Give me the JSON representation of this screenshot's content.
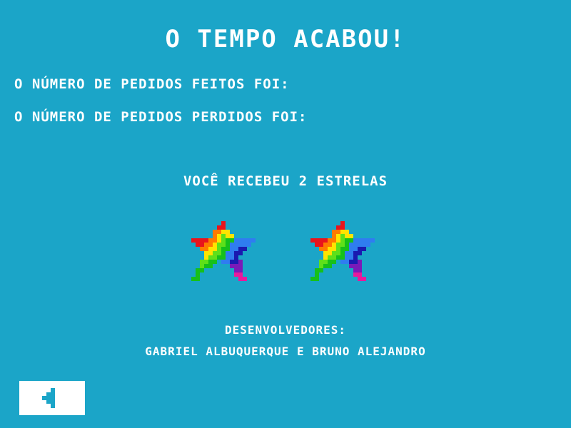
{
  "screen": {
    "title": "O TEMPO ACABOU!",
    "stats": {
      "orders_made_label": "O NÚMERO DE PEDIDOS FEITOS FOI:",
      "orders_lost_label": "O NÚMERO DE PEDIDOS PERDIDOS FOI:"
    },
    "rating": {
      "text": "VOCÊ RECEBEU 2 ESTRELAS",
      "stars_earned": 2
    },
    "credits": {
      "label": "DESENVOLVEDORES:",
      "names": "GABRIEL ALBUQUERQUE E BRUNO ALEJANDRO"
    },
    "back_button": {
      "icon": "back-arrow-icon"
    }
  },
  "colors": {
    "background": "#1ba5c8",
    "text": "#ffffff",
    "button_bg": "#ffffff",
    "button_icon": "#1ba5c8",
    "star_rainbow": [
      "#e8141c",
      "#ff7a00",
      "#ffe400",
      "#5ee01a",
      "#16c01a",
      "#2f7df0",
      "#1a1ab0",
      "#7a1ab8",
      "#e81a9c"
    ]
  }
}
